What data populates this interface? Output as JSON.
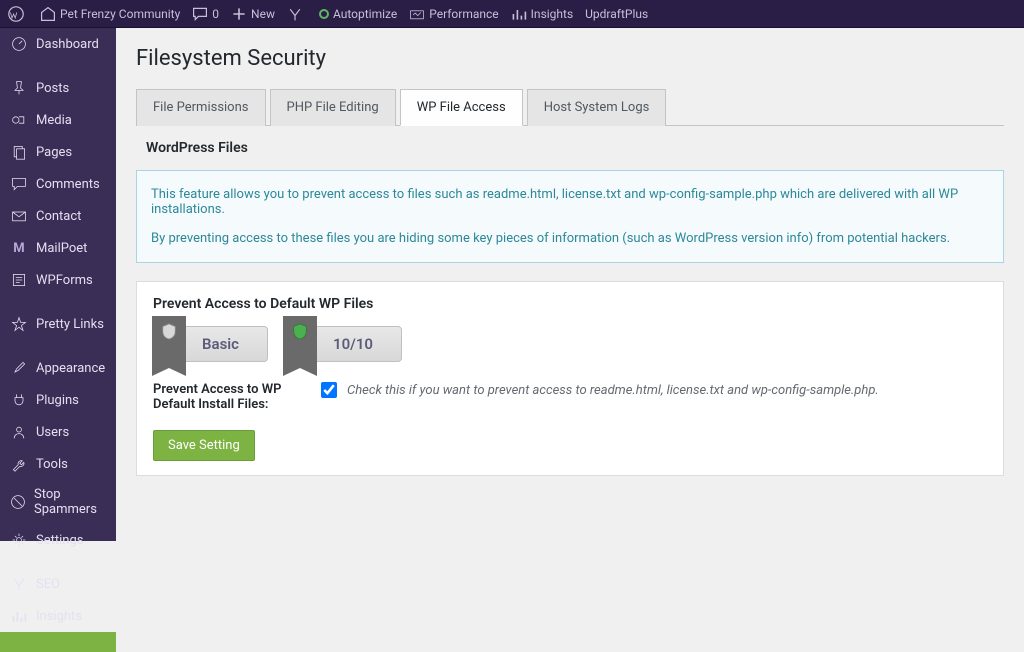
{
  "toolbar": {
    "site_name": "Pet Frenzy Community",
    "comments_count": "0",
    "new_label": "New",
    "autoptimize": "Autoptimize",
    "performance": "Performance",
    "insights": "Insights",
    "updraft": "UpdraftPlus"
  },
  "sidebar": {
    "items": [
      {
        "label": "Dashboard",
        "icon": "dashboard"
      },
      {
        "label": "Posts",
        "icon": "pin"
      },
      {
        "label": "Media",
        "icon": "media"
      },
      {
        "label": "Pages",
        "icon": "pages"
      },
      {
        "label": "Comments",
        "icon": "comment"
      },
      {
        "label": "Contact",
        "icon": "mail"
      },
      {
        "label": "MailPoet",
        "icon": "m"
      },
      {
        "label": "WPForms",
        "icon": "form"
      },
      {
        "label": "Pretty Links",
        "icon": "star"
      },
      {
        "label": "Appearance",
        "icon": "brush"
      },
      {
        "label": "Plugins",
        "icon": "plug"
      },
      {
        "label": "Users",
        "icon": "user"
      },
      {
        "label": "Tools",
        "icon": "wrench"
      },
      {
        "label": "Stop Spammers",
        "icon": "stop"
      },
      {
        "label": "Settings",
        "icon": "gear"
      },
      {
        "label": "SEO",
        "icon": "seo"
      },
      {
        "label": "Insights",
        "icon": "chart"
      }
    ]
  },
  "page": {
    "title": "Filesystem Security",
    "tabs": [
      {
        "label": "File Permissions",
        "active": false
      },
      {
        "label": "PHP File Editing",
        "active": false
      },
      {
        "label": "WP File Access",
        "active": true
      },
      {
        "label": "Host System Logs",
        "active": false
      }
    ],
    "section_title": "WordPress Files",
    "info_p1": "This feature allows you to prevent access to files such as readme.html, license.txt and wp-config-sample.php which are delivered with all WP installations.",
    "info_p2": "By preventing access to these files you are hiding some key pieces of information (such as WordPress version info) from potential hackers.",
    "card_title": "Prevent Access to Default WP Files",
    "badge_basic": "Basic",
    "badge_score": "10/10",
    "form_label": "Prevent Access to WP Default Install Files:",
    "checkbox_label": "Check this if you want to prevent access to readme.html, license.txt and wp-config-sample.php.",
    "checkbox_checked": true,
    "save_button": "Save Setting"
  }
}
